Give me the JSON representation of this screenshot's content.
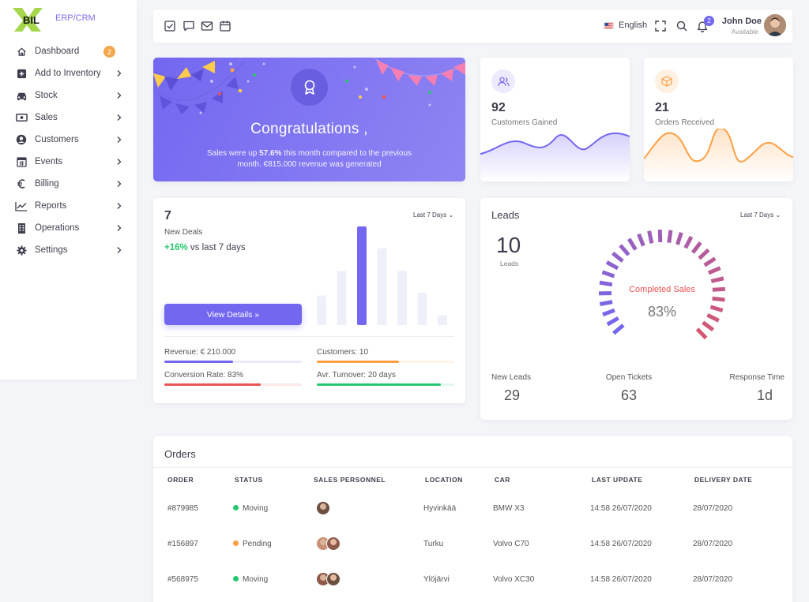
{
  "brand": {
    "logo_text": "BIL",
    "subtitle": "ERP/CRM",
    "accent": "#7367f0"
  },
  "sidebar": {
    "items": [
      {
        "label": "Dashboard",
        "icon": "home-icon",
        "badge": "2"
      },
      {
        "label": "Add to Inventory",
        "icon": "plus-square-icon"
      },
      {
        "label": "Stock",
        "icon": "car-icon"
      },
      {
        "label": "Sales",
        "icon": "money-icon"
      },
      {
        "label": "Customers",
        "icon": "user-circle-icon"
      },
      {
        "label": "Events",
        "icon": "calendar-icon"
      },
      {
        "label": "Billing",
        "icon": "euro-icon"
      },
      {
        "label": "Reports",
        "icon": "line-chart-icon"
      },
      {
        "label": "Operations",
        "icon": "building-icon"
      },
      {
        "label": "Settings",
        "icon": "gear-icon"
      }
    ]
  },
  "topbar": {
    "icons": [
      "check-square-icon",
      "chat-icon",
      "mail-icon",
      "calendar-icon"
    ],
    "language": "English",
    "notifications_count": "2",
    "user_name": "John Doe",
    "user_status": "Available"
  },
  "congrats": {
    "title": "Congratulations ,",
    "text_before": "Sales were up ",
    "highlight": "57.6%",
    "text_after": " this month compared to the previous month. €815.000 revenue was generated"
  },
  "customers_card": {
    "value": "92",
    "label": "Customers Gained",
    "color": "#7367f0"
  },
  "orders_card": {
    "value": "21",
    "label": "Orders Received",
    "color": "#ff9f43"
  },
  "deals": {
    "value": "7",
    "label": "New Deals",
    "growth": "+16%",
    "growth_suffix": " vs last 7 days",
    "period": "Last 7 Days",
    "button": "View Details",
    "bar_values": [
      0.3,
      0.55,
      1.0,
      0.78,
      0.55,
      0.33,
      0.1
    ],
    "metrics": [
      {
        "label": "Revenue: € 210.000",
        "progress": 0.5,
        "color": "#7367f0"
      },
      {
        "label": "Customers: 10",
        "progress": 0.6,
        "color": "#ff9f43"
      },
      {
        "label": "Conversion Rate: 83%",
        "progress": 0.7,
        "color": "#ea5455"
      },
      {
        "label": "Avr. Turnover: 20 days",
        "progress": 0.9,
        "color": "#28c76f"
      }
    ]
  },
  "leads": {
    "title": "Leads",
    "value": "10",
    "value_label": "Leads",
    "period": "Last 7 Days",
    "gauge_label": "Completed Sales",
    "gauge_value": "83%",
    "gauge_percent": 83,
    "stats": [
      {
        "label": "New Leads",
        "value": "29"
      },
      {
        "label": "Open Tickets",
        "value": "63"
      },
      {
        "label": "Response Time",
        "value": "1d"
      }
    ]
  },
  "orders": {
    "title": "Orders",
    "columns": [
      "ORDER",
      "STATUS",
      "SALES PERSONNEL",
      "LOCATION",
      "CAR",
      "LAST UPDATE",
      "DELIVERY DATE"
    ],
    "rows": [
      {
        "order": "#879985",
        "status": "Moving",
        "status_color": "#28c76f",
        "personnel_count": 1,
        "location": "Hyvinkää",
        "car": "BMW X3",
        "last_update": "14:58 26/07/2020",
        "delivery": "28/07/2020"
      },
      {
        "order": "#156897",
        "status": "Pending",
        "status_color": "#ff9f43",
        "personnel_count": 2,
        "location": "Turku",
        "car": "Volvo C70",
        "last_update": "14:58 26/07/2020",
        "delivery": "28/07/2020"
      },
      {
        "order": "#568975",
        "status": "Moving",
        "status_color": "#28c76f",
        "personnel_count": 2,
        "location": "Ylöjärvi",
        "car": "Volvo XC30",
        "last_update": "14:58 26/07/2020",
        "delivery": "28/07/2020"
      }
    ]
  }
}
